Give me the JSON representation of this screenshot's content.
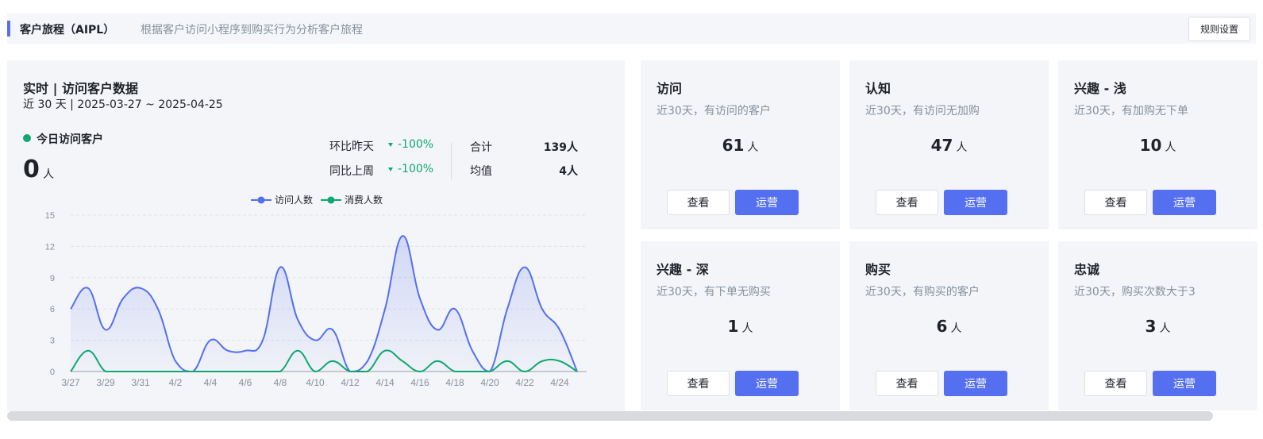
{
  "header": {
    "title": "客户旅程（AIPL）",
    "description": "根据客户访问小程序到购买行为分析客户旅程",
    "rule_button": "规则设置"
  },
  "realtime": {
    "title": "实时 | 访问客户数据",
    "range": "近 30 天 | 2025-03-27 ~ 2025-04-25",
    "today_label": "今日访问客户",
    "today_value": "0",
    "today_unit": "人",
    "dod_label": "环比昨天",
    "dod_value": "-100%",
    "wow_label": "同比上周",
    "wow_value": "-100%",
    "total_label": "合计",
    "total_value": "139人",
    "avg_label": "均值",
    "avg_value": "4人",
    "colors": {
      "up_down": "#0fa86f"
    }
  },
  "chart_data": {
    "type": "area",
    "x": [
      "3/27",
      "3/28",
      "3/29",
      "3/30",
      "3/31",
      "4/1",
      "4/2",
      "4/3",
      "4/4",
      "4/5",
      "4/6",
      "4/7",
      "4/8",
      "4/9",
      "4/10",
      "4/11",
      "4/12",
      "4/13",
      "4/14",
      "4/15",
      "4/16",
      "4/17",
      "4/18",
      "4/19",
      "4/20",
      "4/21",
      "4/22",
      "4/23",
      "4/24",
      "4/25"
    ],
    "x_tick_labels": [
      "3/27",
      "3/29",
      "3/31",
      "4/2",
      "4/4",
      "4/6",
      "4/8",
      "4/10",
      "4/12",
      "4/14",
      "4/16",
      "4/18",
      "4/20",
      "4/22",
      "4/24"
    ],
    "series": [
      {
        "name": "访问人数",
        "color": "#5470f0",
        "values": [
          6,
          8,
          4,
          7,
          8,
          6,
          1,
          0,
          3,
          2,
          2,
          3,
          10,
          5,
          3,
          4,
          0,
          1,
          6,
          13,
          7,
          4,
          6,
          2,
          0,
          6,
          10,
          6,
          4,
          0
        ]
      },
      {
        "name": "消费人数",
        "color": "#0fa86f",
        "values": [
          0,
          2,
          0,
          0,
          0,
          0,
          0,
          0,
          0,
          0,
          0,
          0,
          0,
          2,
          0,
          1,
          0,
          0,
          2,
          1,
          0,
          1,
          0,
          0,
          0,
          1,
          0,
          1,
          1,
          0
        ]
      }
    ],
    "yticks": [
      0,
      3,
      6,
      9,
      12,
      15
    ],
    "ylim": [
      0,
      15
    ],
    "grid": true,
    "legend": "top-center"
  },
  "cards": [
    {
      "title": "访问",
      "desc": "近30天，有访问的客户",
      "value": "61",
      "unit": "人",
      "view": "查看",
      "op": "运营"
    },
    {
      "title": "认知",
      "desc": "近30天，有访问无加购",
      "value": "47",
      "unit": "人",
      "view": "查看",
      "op": "运营"
    },
    {
      "title": "兴趣 - 浅",
      "desc": "近30天，有加购无下单",
      "value": "10",
      "unit": "人",
      "view": "查看",
      "op": "运营"
    },
    {
      "title": "兴趣 - 深",
      "desc": "近30天，有下单无购买",
      "value": "1",
      "unit": "人",
      "view": "查看",
      "op": "运营"
    },
    {
      "title": "购买",
      "desc": "近30天，有购买的客户",
      "value": "6",
      "unit": "人",
      "view": "查看",
      "op": "运营"
    },
    {
      "title": "忠诚",
      "desc": "近30天，购买次数大于3",
      "value": "3",
      "unit": "人",
      "view": "查看",
      "op": "运营"
    }
  ],
  "colors": {
    "accent": "#5470f0",
    "panel_bg": "#f4f5f8"
  }
}
